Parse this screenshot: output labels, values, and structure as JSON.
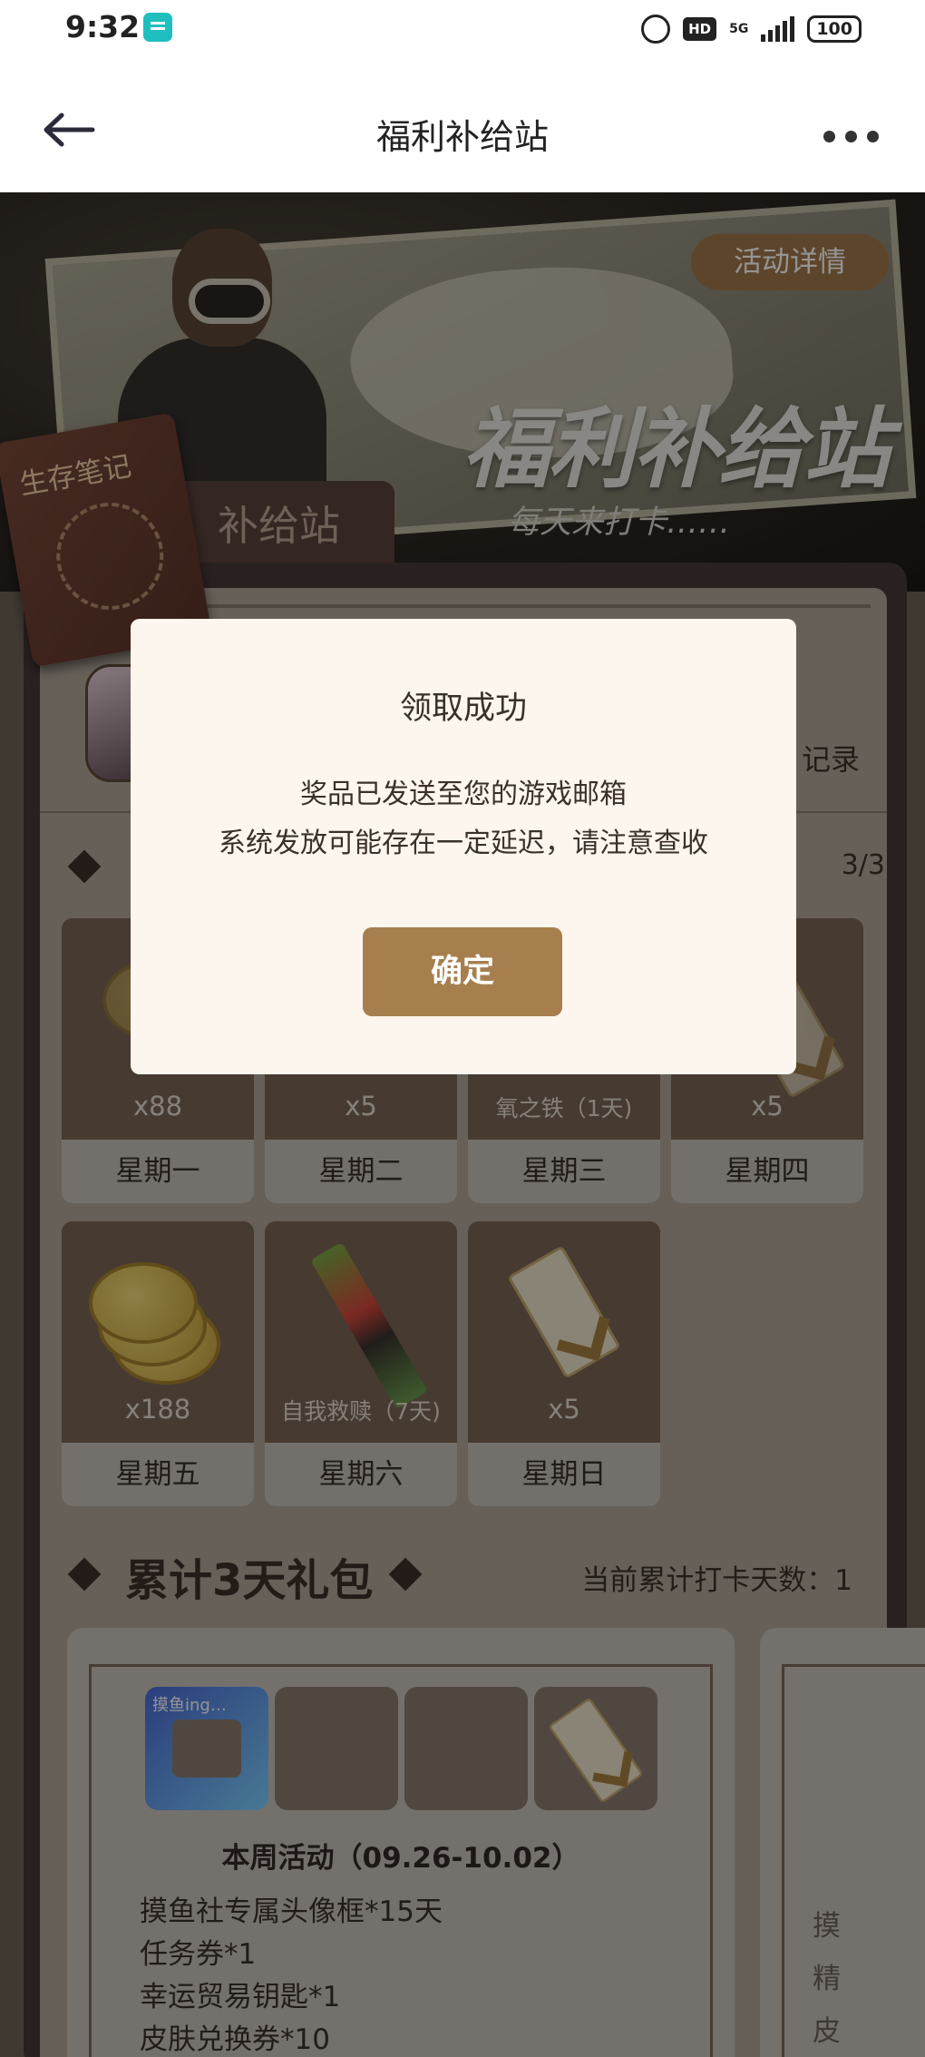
{
  "status_bar": {
    "time": "9:32",
    "hd": "HD",
    "network": "5G",
    "battery": "100"
  },
  "nav": {
    "title": "福利补给站"
  },
  "banner": {
    "detail_button": "活动详情",
    "big_title": "福利补给站",
    "subtitle": "每天来打卡……",
    "tab_label": "补给站",
    "notebook_label": "生存笔记"
  },
  "panel": {
    "record_label": "记录",
    "progress": "3/3"
  },
  "days": [
    {
      "label": "星期一",
      "qty": "x88"
    },
    {
      "label": "星期二",
      "qty": "x5"
    },
    {
      "label": "星期三",
      "qty": "氧之铁（1天)"
    },
    {
      "label": "星期四",
      "qty": "x5"
    },
    {
      "label": "星期五",
      "qty": "x188"
    },
    {
      "label": "星期六",
      "qty": "自我救赎（7天)"
    },
    {
      "label": "星期日",
      "qty": "x5"
    }
  ],
  "cumulative": {
    "title": "累计3天礼包",
    "days_text": "当前累计打卡天数：1",
    "card": {
      "avatar_tag": "摸鱼ing…",
      "week": "本周活动（09.26-10.02）",
      "rewards": [
        "摸鱼社专属头像框*15天",
        "任务券*1",
        "幸运贸易钥匙*1",
        "皮肤兑换券*10"
      ]
    },
    "card2": {
      "lines": [
        "摸",
        "精",
        "皮"
      ]
    }
  },
  "dialog": {
    "title": "领取成功",
    "line1": "奖品已发送至您的游戏邮箱",
    "line2": "系统发放可能存在一定延迟，请注意查收",
    "confirm": "确定"
  }
}
